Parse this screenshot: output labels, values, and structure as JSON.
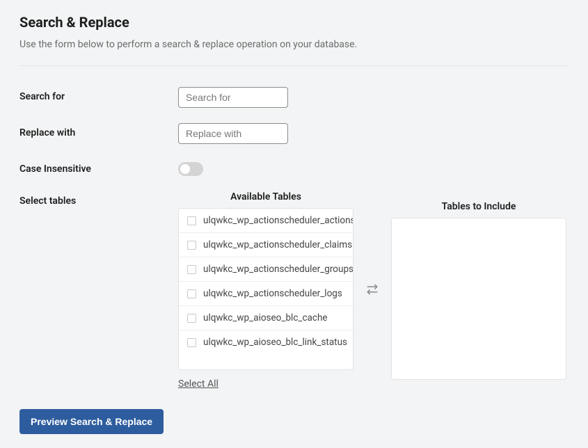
{
  "header": {
    "title": "Search & Replace",
    "subtitle": "Use the form below to perform a search & replace operation on your database."
  },
  "form": {
    "search": {
      "label": "Search for",
      "placeholder": "Search for"
    },
    "replace": {
      "label": "Replace with",
      "placeholder": "Replace with"
    },
    "case_insensitive": {
      "label": "Case Insensitive"
    },
    "select_tables": {
      "label": "Select tables"
    }
  },
  "tables": {
    "available_title": "Available Tables",
    "include_title": "Tables to Include",
    "available": [
      "ulqwkc_wp_actionscheduler_actions",
      "ulqwkc_wp_actionscheduler_claims",
      "ulqwkc_wp_actionscheduler_groups",
      "ulqwkc_wp_actionscheduler_logs",
      "ulqwkc_wp_aioseo_blc_cache",
      "ulqwkc_wp_aioseo_blc_link_status"
    ],
    "select_all": "Select All"
  },
  "actions": {
    "preview": "Preview Search & Replace"
  }
}
